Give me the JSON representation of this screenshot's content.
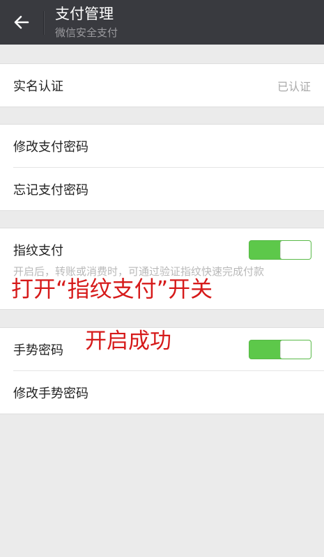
{
  "header": {
    "title": "支付管理",
    "subtitle": "微信安全支付",
    "back_icon": "arrow-left-icon"
  },
  "realname": {
    "label": "实名认证",
    "status": "已认证"
  },
  "password": {
    "modify_label": "修改支付密码",
    "forgot_label": "忘记支付密码"
  },
  "fingerprint": {
    "label": "指纹支付",
    "enabled": true,
    "description": "开启后，转账或消费时，可通过验证指纹快速完成付款"
  },
  "gesture": {
    "label": "手势密码",
    "enabled": true,
    "modify_label": "修改手势密码"
  },
  "annotations": {
    "step_text": "打开“指纹支付”开关",
    "result_text": "开启成功",
    "color": "#d61a1a"
  },
  "colors": {
    "header_bg": "#393a3f",
    "toggle_on": "#5dc84a"
  }
}
